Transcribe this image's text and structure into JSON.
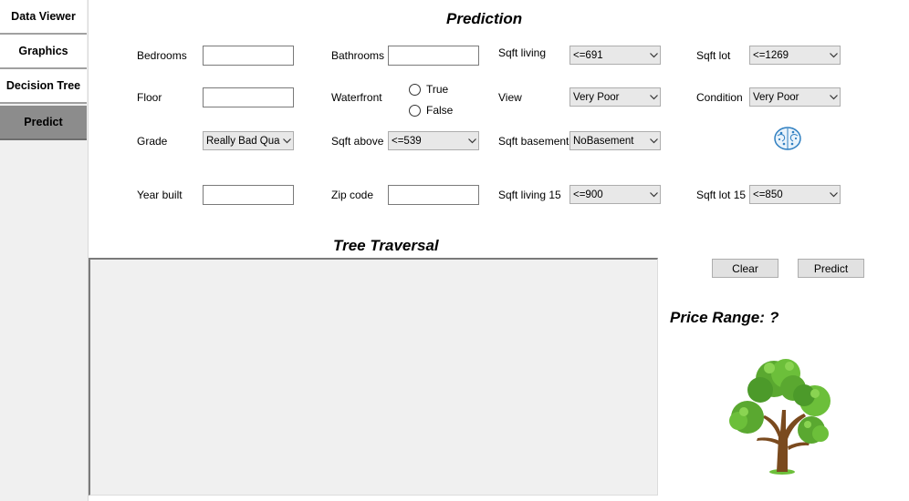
{
  "sidebar": {
    "items": [
      {
        "label": "Data Viewer"
      },
      {
        "label": "Graphics"
      },
      {
        "label": "Decision Tree"
      },
      {
        "label": "Predict"
      }
    ]
  },
  "prediction": {
    "title": "Prediction",
    "bedrooms_label": "Bedrooms",
    "bathrooms_label": "Bathrooms",
    "sqft_living_label": "Sqft living",
    "sqft_living_value": "<=691",
    "sqft_lot_label": "Sqft lot",
    "sqft_lot_value": "<=1269",
    "floor_label": "Floor",
    "waterfront_label": "Waterfront",
    "waterfront_true": "True",
    "waterfront_false": "False",
    "view_label": "View",
    "view_value": "Very Poor",
    "condition_label": "Condition",
    "condition_value": "Very Poor",
    "grade_label": "Grade",
    "grade_value": "Really Bad Qua",
    "sqft_above_label": "Sqft above",
    "sqft_above_value": "<=539",
    "sqft_basement_label": "Sqft basement",
    "sqft_basement_value": "NoBasement",
    "year_built_label": "Year built",
    "zip_code_label": "Zip code",
    "sqft_living15_label": "Sqft living 15",
    "sqft_living15_value": "<=900",
    "sqft_lot15_label": "Sqft lot 15",
    "sqft_lot15_value": "<=850"
  },
  "traversal": {
    "title": "Tree Traversal"
  },
  "buttons": {
    "clear": "Clear",
    "predict": "Predict"
  },
  "result": {
    "label": "Price Range:",
    "value": "?"
  },
  "icons": {
    "brain": "brain-icon",
    "tree": "tree-illustration",
    "dropdown": "chevron-down-icon"
  },
  "colors": {
    "active_tab": "#8c8c8c",
    "panel_bg": "#f0f0f0",
    "brain_blue": "#2f7fc1",
    "leaf_green": "#6cbf3a",
    "trunk_brown": "#7a4a1e"
  }
}
